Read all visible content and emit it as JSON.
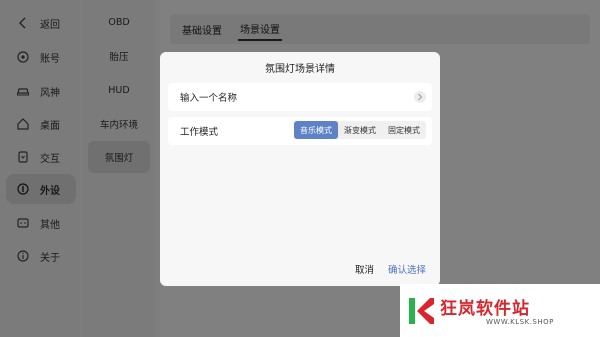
{
  "nav": {
    "items": [
      {
        "label": "返回",
        "icon": "back-icon"
      },
      {
        "label": "账号",
        "icon": "account-icon"
      },
      {
        "label": "风神",
        "icon": "car-icon"
      },
      {
        "label": "桌面",
        "icon": "home-icon"
      },
      {
        "label": "交互",
        "icon": "interaction-icon"
      },
      {
        "label": "外设",
        "icon": "peripheral-icon",
        "active": true
      },
      {
        "label": "其他",
        "icon": "other-icon"
      },
      {
        "label": "关于",
        "icon": "info-icon"
      }
    ]
  },
  "subnav": {
    "items": [
      {
        "label": "OBD"
      },
      {
        "label": "胎压"
      },
      {
        "label": "HUD"
      },
      {
        "label": "车内环境"
      },
      {
        "label": "氛围灯",
        "active": true
      }
    ]
  },
  "tabs": [
    {
      "label": "基础设置"
    },
    {
      "label": "场景设置",
      "active": true
    }
  ],
  "dialog": {
    "title": "氛围灯场景详情",
    "name_row": {
      "label": "输入一个名称"
    },
    "mode_row": {
      "label": "工作模式",
      "options": [
        "音乐模式",
        "渐变模式",
        "固定模式"
      ],
      "selected": "音乐模式"
    },
    "cancel_label": "取消",
    "confirm_label": "确认选择"
  },
  "watermark": {
    "name": "狂岚软件站",
    "url": "WWW.KLSK.SHOP"
  },
  "colors": {
    "accent": "#5f82c6",
    "confirm": "#4a72c4",
    "brand": "#d8262d"
  }
}
